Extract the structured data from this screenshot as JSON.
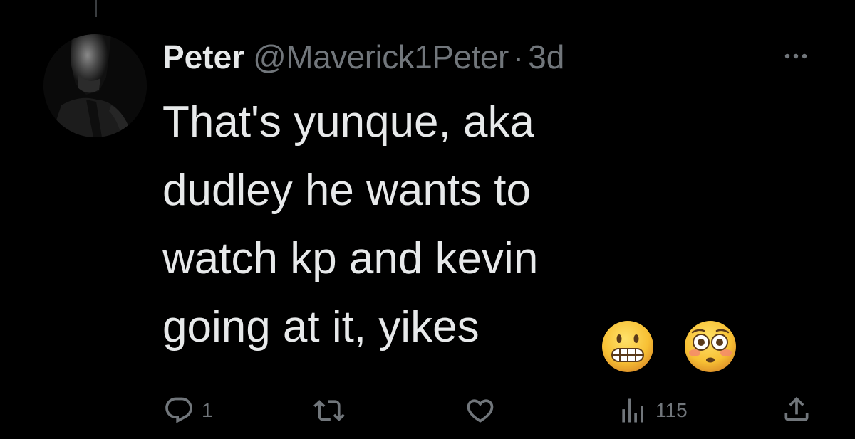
{
  "tweet": {
    "display_name": "Peter",
    "handle": "@Maverick1Peter",
    "separator": "·",
    "timestamp": "3d",
    "text": "That's yunque, aka\ndudley he wants to\nwatch kp and kevin\ngoing at it, yikes",
    "emojis": [
      "grimacing-face",
      "flushed-face"
    ]
  },
  "actions": {
    "reply_count": "1",
    "retweet_count": "",
    "like_count": "",
    "views_count": "115"
  },
  "colors": {
    "background": "#000000",
    "primary_text": "#e7e9ea",
    "secondary_text": "#71767b",
    "emoji_yellow": "#f7c034"
  },
  "icons": {
    "more": "more-horizontal-icon",
    "reply": "reply-bubble-icon",
    "retweet": "retweet-icon",
    "like": "heart-icon",
    "views": "analytics-bars-icon",
    "share": "share-upload-icon"
  }
}
